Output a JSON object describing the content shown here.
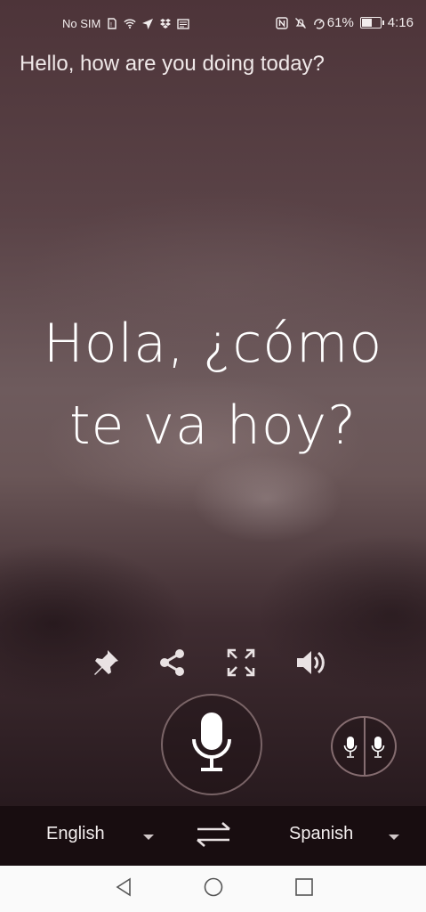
{
  "status_bar": {
    "carrier": "No SIM",
    "battery_percent": "61%",
    "battery_level": 0.61,
    "time": "4:16",
    "left_icons": [
      "sim-icon",
      "wifi-icon",
      "airplane-icon",
      "dropbox-icon",
      "news-icon"
    ],
    "right_icons": [
      "nfc-icon",
      "mute-icon",
      "sync-icon",
      "battery-icon"
    ]
  },
  "conversation": {
    "source_text": "Hello, how are you doing today?",
    "translated_line_1": "Hola, ¿cómo",
    "translated_line_2": "te va hoy?"
  },
  "actions": {
    "icons": [
      "pin-icon",
      "share-icon",
      "fullscreen-icon",
      "speaker-icon"
    ]
  },
  "voice": {
    "mic_icon": "microphone-icon",
    "split_mic_icon": "dual-microphone-icon"
  },
  "languages": {
    "source": "English",
    "target": "Spanish",
    "swap_icon": "swap-arrows-icon"
  },
  "nav": {
    "icons": [
      "back-icon",
      "home-icon",
      "recents-icon"
    ]
  },
  "colors": {
    "text": "#ffffff",
    "language_bar": "#180d10",
    "nav_bar": "#fafafa"
  }
}
